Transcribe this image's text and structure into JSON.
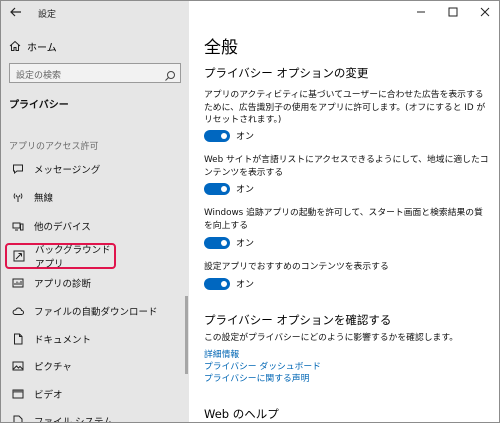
{
  "window": {
    "title": "設定",
    "controls": [
      "minimize",
      "maximize",
      "close"
    ]
  },
  "sidebar": {
    "home_label": "ホーム",
    "search_placeholder": "設定の検索",
    "section_title": "プライバシー",
    "group_label": "アプリのアクセス許可",
    "items": [
      {
        "label": "メッセージング",
        "icon": "message-icon"
      },
      {
        "label": "無線",
        "icon": "radio-icon"
      },
      {
        "label": "他のデバイス",
        "icon": "devices-icon"
      },
      {
        "label": "バックグラウンド アプリ",
        "icon": "background-apps-icon",
        "active": true
      },
      {
        "label": "アプリの診断",
        "icon": "diagnostics-icon"
      },
      {
        "label": "ファイルの自動ダウンロード",
        "icon": "cloud-icon"
      },
      {
        "label": "ドキュメント",
        "icon": "document-icon"
      },
      {
        "label": "ピクチャ",
        "icon": "picture-icon"
      },
      {
        "label": "ビデオ",
        "icon": "video-icon"
      },
      {
        "label": "ファイル システム",
        "icon": "filesystem-icon"
      }
    ]
  },
  "main": {
    "title": "全般",
    "section1_heading": "プライバシー オプションの変更",
    "settings": [
      {
        "description": "アプリのアクティビティに基づいてユーザーに合わせた広告を表示するために、広告識別子の使用をアプリに許可します。(オフにすると ID がリセットされます。)",
        "state": "オン"
      },
      {
        "description": "Web サイトが言語リストにアクセスできるようにして、地域に適したコンテンツを表示する",
        "state": "オン"
      },
      {
        "description": "Windows 追跡アプリの起動を許可して、スタート画面と検索結果の質を向上する",
        "state": "オン"
      },
      {
        "description": "設定アプリでおすすめのコンテンツを表示する",
        "state": "オン"
      }
    ],
    "section2_heading": "プライバシー オプションを確認する",
    "section2_desc": "この設定がプライバシーにどのように影響するかを確認します。",
    "links": [
      "詳細情報",
      "プライバシー ダッシュボード",
      "プライバシーに関する声明"
    ],
    "section3_heading": "Web のヘルプ"
  },
  "colors": {
    "accent": "#0067c0",
    "highlight_border": "#e0144c",
    "sidebar_bg": "#e6e6e6",
    "link": "#0066b4"
  }
}
